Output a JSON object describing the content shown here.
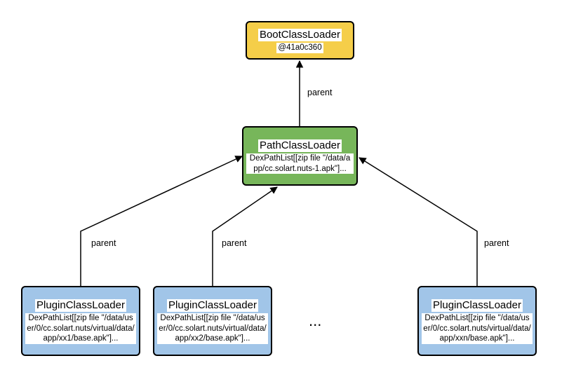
{
  "nodes": {
    "boot": {
      "title": "BootClassLoader",
      "sub": "@41a0c360"
    },
    "path": {
      "title": "PathClassLoader",
      "sub": "DexPathList[[zip file \"/data/app/cc.solart.nuts-1.apk\"]..."
    },
    "p1": {
      "title": "PluginClassLoader",
      "sub": "DexPathList[[zip file \"/data/user/0/cc.solart.nuts/virtual/data/app/xx1/base.apk\"]..."
    },
    "p2": {
      "title": "PluginClassLoader",
      "sub": "DexPathList[[zip file \"/data/user/0/cc.solart.nuts/virtual/data/app/xx2/base.apk\"]..."
    },
    "pn": {
      "title": "PluginClassLoader",
      "sub": "DexPathList[[zip file \"/data/user/0/cc.solart.nuts/virtual/data/app/xxn/base.apk\"]..."
    }
  },
  "ellipsis": "...",
  "edges": {
    "parent": "parent"
  }
}
